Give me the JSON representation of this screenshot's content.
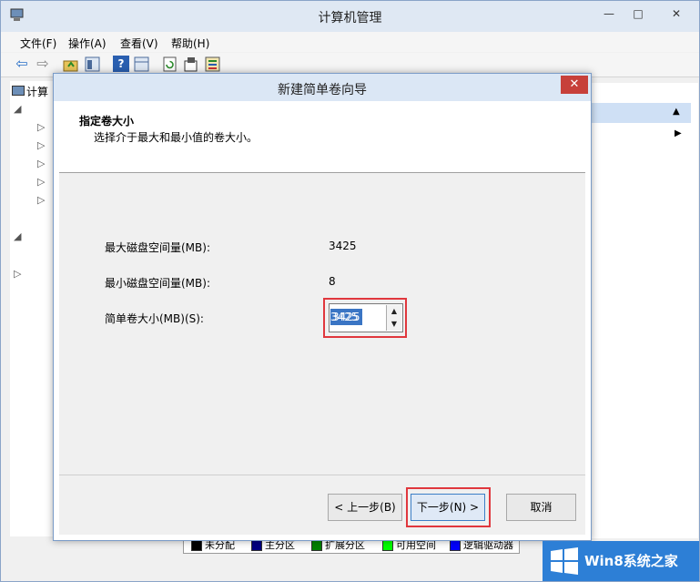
{
  "window": {
    "title": "计算机管理",
    "min_glyph": "—",
    "max_glyph": "□",
    "close_glyph": "✕"
  },
  "menu": [
    {
      "label": "文件(F)"
    },
    {
      "label": "操作(A)"
    },
    {
      "label": "查看(V)"
    },
    {
      "label": "帮助(H)"
    }
  ],
  "toolbar": {
    "back_glyph": "⇦",
    "forward_glyph": "⇨",
    "help_glyph": "?"
  },
  "tree": {
    "root_label": "计算"
  },
  "legend": [
    {
      "label": "未分配",
      "color": "#000000"
    },
    {
      "label": "主分区",
      "color": "#000080"
    },
    {
      "label": "扩展分区",
      "color": "#008000"
    },
    {
      "label": "可用空间",
      "color": "#00ff00"
    },
    {
      "label": "逻辑驱动器",
      "color": "#0000ff"
    }
  ],
  "wizard": {
    "title": "新建简单卷向导",
    "close_glyph": "✕",
    "header_title": "指定卷大小",
    "header_subtitle": "选择介于最大和最小值的卷大小。",
    "max_label": "最大磁盘空间量(MB):",
    "max_value": "3425",
    "min_label": "最小磁盘空间量(MB):",
    "min_value": "8",
    "size_label": "简单卷大小(MB)(S):",
    "size_value": "3425",
    "back_button": "< 上一步(B)",
    "next_button": "下一步(N) >",
    "cancel_button": "取消"
  },
  "watermark": {
    "text": "Win8系统之家"
  },
  "colors": {
    "highlight": "#e0373d",
    "selection": "#3a75c4",
    "close_red": "#c7403a",
    "watermark_blue": "#2d7fd6"
  }
}
